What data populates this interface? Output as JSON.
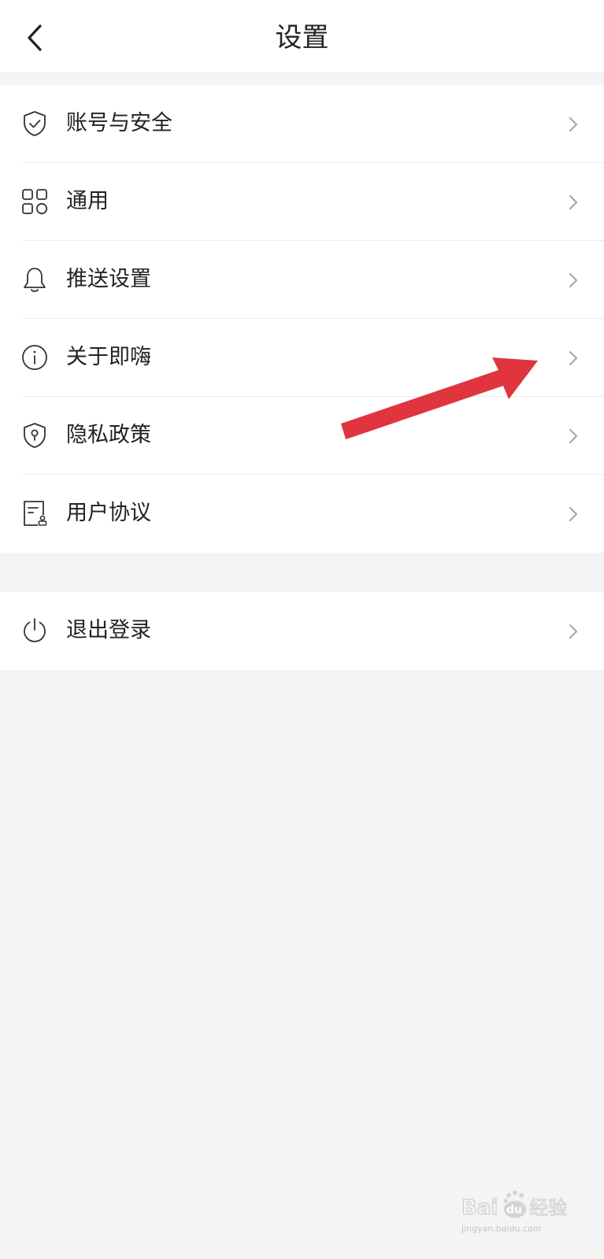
{
  "header": {
    "title": "设置",
    "back_icon": "chevron-left-icon"
  },
  "settings_items": [
    {
      "label": "账号与安全",
      "icon": "shield-check-icon"
    },
    {
      "label": "通用",
      "icon": "grid-icon"
    },
    {
      "label": "推送设置",
      "icon": "bell-icon"
    },
    {
      "label": "关于即嗨",
      "icon": "info-icon"
    },
    {
      "label": "隐私政策",
      "icon": "shield-lock-icon"
    },
    {
      "label": "用户协议",
      "icon": "document-icon"
    }
  ],
  "logout": {
    "label": "退出登录",
    "icon": "power-icon"
  },
  "colors": {
    "background": "#f4f4f4",
    "card": "#ffffff",
    "text": "#222222",
    "chevron": "#a8a8a8",
    "annotation_arrow": "#e0343f"
  },
  "watermark": {
    "logo_text": "Bai du 经验",
    "url_text": "jingyan.baidu.com"
  }
}
